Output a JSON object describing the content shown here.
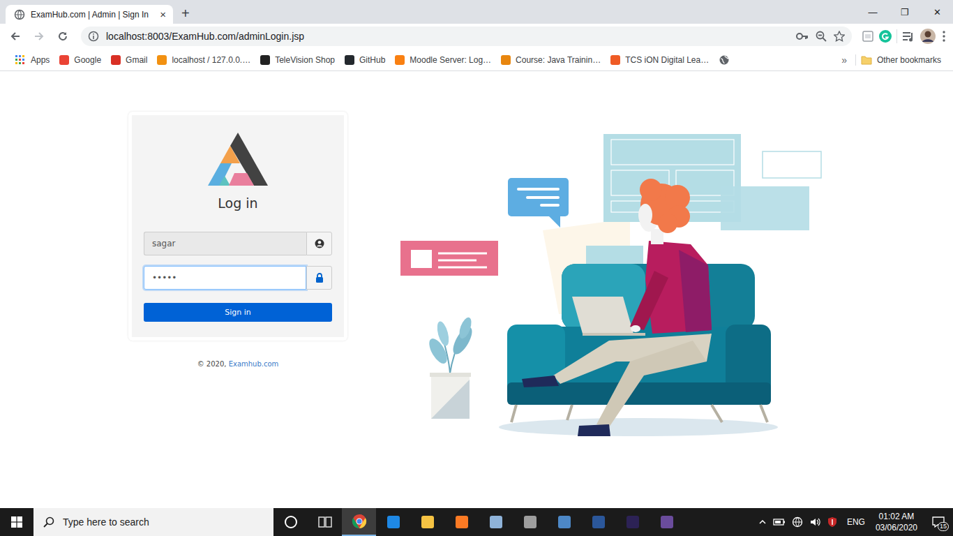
{
  "tabs": [
    {
      "label": "ExamHub.com | Admin | Sign In",
      "close": "×",
      "selected": true
    }
  ],
  "new_tab": "+",
  "window_controls": [
    "—",
    "❐",
    "✕"
  ],
  "address_bar": {
    "url": "localhost:8003/ExamHub.com/adminLogin.jsp"
  },
  "bookmarks": {
    "items": [
      {
        "label": "Apps",
        "color": "#4285f4"
      },
      {
        "label": "Google",
        "color": "#ea4335"
      },
      {
        "label": "Gmail",
        "color": "#d93025"
      },
      {
        "label": "localhost / 127.0.0.…",
        "color": "#f29111"
      },
      {
        "label": "TeleVision Shop",
        "color": "#222222"
      },
      {
        "label": "GitHub",
        "color": "#24292e"
      },
      {
        "label": "Moodle Server: Log…",
        "color": "#f98012"
      },
      {
        "label": "Course: Java Trainin…",
        "color": "#e8860f"
      },
      {
        "label": "TCS iON Digital Lea…",
        "color": "#ef5b25"
      }
    ],
    "more": "»",
    "other": "Other bookmarks"
  },
  "login": {
    "heading": "Log in",
    "username": "sagar",
    "password": "•••••",
    "password_focused": true,
    "button": "Sign in"
  },
  "footer": {
    "prefix": "© 2020, ",
    "link": "Examhub.com"
  },
  "taskbar": {
    "search_placeholder": "Type here to search",
    "apps": [
      {
        "selected": false,
        "color": "#ffffff"
      },
      {
        "selected": false,
        "color": "#dddddd"
      },
      {
        "selected": true,
        "color": "#db4437"
      },
      {
        "selected": false,
        "color": "#1e88e5"
      },
      {
        "selected": false,
        "color": "#f6c343"
      },
      {
        "selected": false,
        "color": "#fb7a24"
      },
      {
        "selected": false,
        "color": "#8fb3d9"
      },
      {
        "selected": false,
        "color": "#9e9e9e"
      },
      {
        "selected": false,
        "color": "#4d88c7"
      },
      {
        "selected": false,
        "color": "#2b579a"
      },
      {
        "selected": false,
        "color": "#2c2255"
      },
      {
        "selected": false,
        "color": "#6a4c9c"
      }
    ],
    "language": "ENG",
    "time": "01:02 AM",
    "date": "03/06/2020",
    "notifications": "15"
  }
}
